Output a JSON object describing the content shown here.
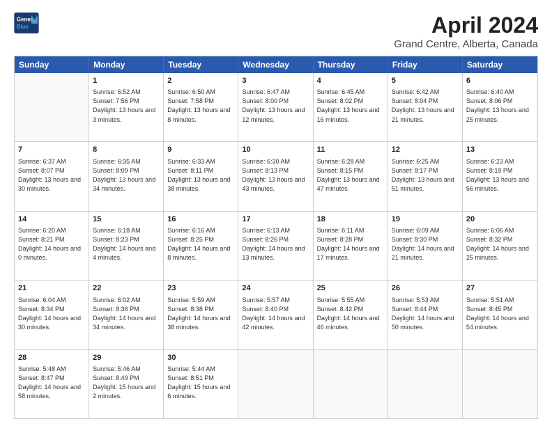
{
  "header": {
    "logo_line1": "General",
    "logo_line2": "Blue",
    "title": "April 2024",
    "subtitle": "Grand Centre, Alberta, Canada"
  },
  "weekdays": [
    "Sunday",
    "Monday",
    "Tuesday",
    "Wednesday",
    "Thursday",
    "Friday",
    "Saturday"
  ],
  "weeks": [
    [
      {
        "day": "",
        "sunrise": "",
        "sunset": "",
        "daylight": ""
      },
      {
        "day": "1",
        "sunrise": "Sunrise: 6:52 AM",
        "sunset": "Sunset: 7:56 PM",
        "daylight": "Daylight: 13 hours and 3 minutes."
      },
      {
        "day": "2",
        "sunrise": "Sunrise: 6:50 AM",
        "sunset": "Sunset: 7:58 PM",
        "daylight": "Daylight: 13 hours and 8 minutes."
      },
      {
        "day": "3",
        "sunrise": "Sunrise: 6:47 AM",
        "sunset": "Sunset: 8:00 PM",
        "daylight": "Daylight: 13 hours and 12 minutes."
      },
      {
        "day": "4",
        "sunrise": "Sunrise: 6:45 AM",
        "sunset": "Sunset: 8:02 PM",
        "daylight": "Daylight: 13 hours and 16 minutes."
      },
      {
        "day": "5",
        "sunrise": "Sunrise: 6:42 AM",
        "sunset": "Sunset: 8:04 PM",
        "daylight": "Daylight: 13 hours and 21 minutes."
      },
      {
        "day": "6",
        "sunrise": "Sunrise: 6:40 AM",
        "sunset": "Sunset: 8:06 PM",
        "daylight": "Daylight: 13 hours and 25 minutes."
      }
    ],
    [
      {
        "day": "7",
        "sunrise": "Sunrise: 6:37 AM",
        "sunset": "Sunset: 8:07 PM",
        "daylight": "Daylight: 13 hours and 30 minutes."
      },
      {
        "day": "8",
        "sunrise": "Sunrise: 6:35 AM",
        "sunset": "Sunset: 8:09 PM",
        "daylight": "Daylight: 13 hours and 34 minutes."
      },
      {
        "day": "9",
        "sunrise": "Sunrise: 6:33 AM",
        "sunset": "Sunset: 8:11 PM",
        "daylight": "Daylight: 13 hours and 38 minutes."
      },
      {
        "day": "10",
        "sunrise": "Sunrise: 6:30 AM",
        "sunset": "Sunset: 8:13 PM",
        "daylight": "Daylight: 13 hours and 43 minutes."
      },
      {
        "day": "11",
        "sunrise": "Sunrise: 6:28 AM",
        "sunset": "Sunset: 8:15 PM",
        "daylight": "Daylight: 13 hours and 47 minutes."
      },
      {
        "day": "12",
        "sunrise": "Sunrise: 6:25 AM",
        "sunset": "Sunset: 8:17 PM",
        "daylight": "Daylight: 13 hours and 51 minutes."
      },
      {
        "day": "13",
        "sunrise": "Sunrise: 6:23 AM",
        "sunset": "Sunset: 8:19 PM",
        "daylight": "Daylight: 13 hours and 56 minutes."
      }
    ],
    [
      {
        "day": "14",
        "sunrise": "Sunrise: 6:20 AM",
        "sunset": "Sunset: 8:21 PM",
        "daylight": "Daylight: 14 hours and 0 minutes."
      },
      {
        "day": "15",
        "sunrise": "Sunrise: 6:18 AM",
        "sunset": "Sunset: 8:23 PM",
        "daylight": "Daylight: 14 hours and 4 minutes."
      },
      {
        "day": "16",
        "sunrise": "Sunrise: 6:16 AM",
        "sunset": "Sunset: 8:25 PM",
        "daylight": "Daylight: 14 hours and 8 minutes."
      },
      {
        "day": "17",
        "sunrise": "Sunrise: 6:13 AM",
        "sunset": "Sunset: 8:26 PM",
        "daylight": "Daylight: 14 hours and 13 minutes."
      },
      {
        "day": "18",
        "sunrise": "Sunrise: 6:11 AM",
        "sunset": "Sunset: 8:28 PM",
        "daylight": "Daylight: 14 hours and 17 minutes."
      },
      {
        "day": "19",
        "sunrise": "Sunrise: 6:09 AM",
        "sunset": "Sunset: 8:30 PM",
        "daylight": "Daylight: 14 hours and 21 minutes."
      },
      {
        "day": "20",
        "sunrise": "Sunrise: 6:06 AM",
        "sunset": "Sunset: 8:32 PM",
        "daylight": "Daylight: 14 hours and 25 minutes."
      }
    ],
    [
      {
        "day": "21",
        "sunrise": "Sunrise: 6:04 AM",
        "sunset": "Sunset: 8:34 PM",
        "daylight": "Daylight: 14 hours and 30 minutes."
      },
      {
        "day": "22",
        "sunrise": "Sunrise: 6:02 AM",
        "sunset": "Sunset: 8:36 PM",
        "daylight": "Daylight: 14 hours and 34 minutes."
      },
      {
        "day": "23",
        "sunrise": "Sunrise: 5:59 AM",
        "sunset": "Sunset: 8:38 PM",
        "daylight": "Daylight: 14 hours and 38 minutes."
      },
      {
        "day": "24",
        "sunrise": "Sunrise: 5:57 AM",
        "sunset": "Sunset: 8:40 PM",
        "daylight": "Daylight: 14 hours and 42 minutes."
      },
      {
        "day": "25",
        "sunrise": "Sunrise: 5:55 AM",
        "sunset": "Sunset: 8:42 PM",
        "daylight": "Daylight: 14 hours and 46 minutes."
      },
      {
        "day": "26",
        "sunrise": "Sunrise: 5:53 AM",
        "sunset": "Sunset: 8:44 PM",
        "daylight": "Daylight: 14 hours and 50 minutes."
      },
      {
        "day": "27",
        "sunrise": "Sunrise: 5:51 AM",
        "sunset": "Sunset: 8:45 PM",
        "daylight": "Daylight: 14 hours and 54 minutes."
      }
    ],
    [
      {
        "day": "28",
        "sunrise": "Sunrise: 5:48 AM",
        "sunset": "Sunset: 8:47 PM",
        "daylight": "Daylight: 14 hours and 58 minutes."
      },
      {
        "day": "29",
        "sunrise": "Sunrise: 5:46 AM",
        "sunset": "Sunset: 8:49 PM",
        "daylight": "Daylight: 15 hours and 2 minutes."
      },
      {
        "day": "30",
        "sunrise": "Sunrise: 5:44 AM",
        "sunset": "Sunset: 8:51 PM",
        "daylight": "Daylight: 15 hours and 6 minutes."
      },
      {
        "day": "",
        "sunrise": "",
        "sunset": "",
        "daylight": ""
      },
      {
        "day": "",
        "sunrise": "",
        "sunset": "",
        "daylight": ""
      },
      {
        "day": "",
        "sunrise": "",
        "sunset": "",
        "daylight": ""
      },
      {
        "day": "",
        "sunrise": "",
        "sunset": "",
        "daylight": ""
      }
    ]
  ]
}
